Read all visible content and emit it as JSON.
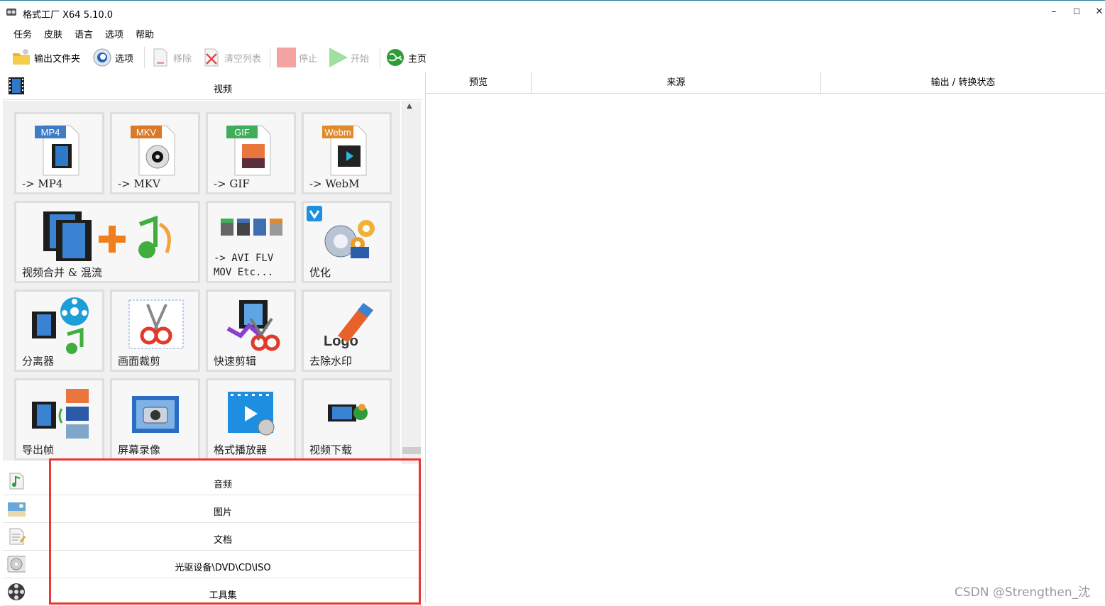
{
  "window": {
    "title": "格式工厂 X64 5.10.0",
    "controls": {
      "minimize": "–",
      "maximize": "☐",
      "close": "✕"
    }
  },
  "menu": [
    "任务",
    "皮肤",
    "语言",
    "选项",
    "帮助"
  ],
  "toolbar": {
    "output_folder": "输出文件夹",
    "options": "选项",
    "remove": "移除",
    "clear_list": "清空列表",
    "stop": "停止",
    "start": "开始",
    "home": "主页"
  },
  "categories": {
    "video": "视频",
    "audio": "音频",
    "image": "图片",
    "document": "文档",
    "disc": "光驱设备\\DVD\\CD\\ISO",
    "tools": "工具集"
  },
  "video_tiles": {
    "mp4": {
      "badge": "MP4",
      "label": "-> MP4"
    },
    "mkv": {
      "badge": "MKV",
      "label": "-> MKV"
    },
    "gif": {
      "badge": "GIF",
      "label": "-> GIF"
    },
    "webm": {
      "badge": "Webm",
      "label": "-> WebM"
    },
    "merge": {
      "label": "视频合并 & 混流"
    },
    "other_formats": {
      "label": "-> AVI FLV\nMOV Etc..."
    },
    "optimize": {
      "label": "优化"
    },
    "splitter": {
      "label": "分离器"
    },
    "crop": {
      "label": "画面裁剪"
    },
    "quick_clip": {
      "label": "快速剪辑"
    },
    "remove_logo": {
      "label": "去除水印",
      "logo_text": "Logo"
    },
    "export_frames": {
      "label": "导出帧"
    },
    "screen_record": {
      "label": "屏幕录像"
    },
    "player": {
      "label": "格式播放器"
    },
    "download": {
      "label": "视频下载"
    }
  },
  "task_table": {
    "columns": [
      "预览",
      "来源",
      "输出 / 转换状态"
    ]
  },
  "watermark": "CSDN @Strengthen_沈"
}
